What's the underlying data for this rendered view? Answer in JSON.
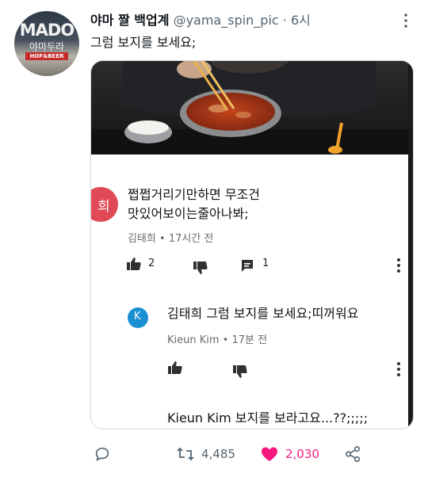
{
  "tweet": {
    "display_name": "야마 짤 백업계",
    "handle": "@yama_spin_pic",
    "separator": "·",
    "time": "6시",
    "text": "그럼 보지를 보세요;",
    "avatar_sign": {
      "top": "MADO",
      "middle": "야마두라",
      "bottom": "HOF&BEER"
    }
  },
  "embedded_screenshot": {
    "comment": {
      "avatar_initial": "희",
      "text_line1": "쩝쩝거리기만하면 무조건",
      "text_line2": "맛있어보이는줄아나봐;",
      "meta": "김태희 • 17시간 전",
      "like_count": "2",
      "reply_count": "1"
    },
    "reply": {
      "avatar_initial": "K",
      "text": "김태희 그럼 보지를 보세요;띠꺼워요",
      "meta": "Kieun Kim • 17분 전"
    },
    "partial_reply": {
      "text": "Kieun Kim 보지를 보라고요...??;;;;;"
    }
  },
  "actions": {
    "reply_count": "",
    "retweet_count": "4,485",
    "like_count": "2,030",
    "like_color": "#f91880",
    "icons": [
      "reply-icon",
      "retweet-icon",
      "heart-icon",
      "share-icon"
    ]
  }
}
